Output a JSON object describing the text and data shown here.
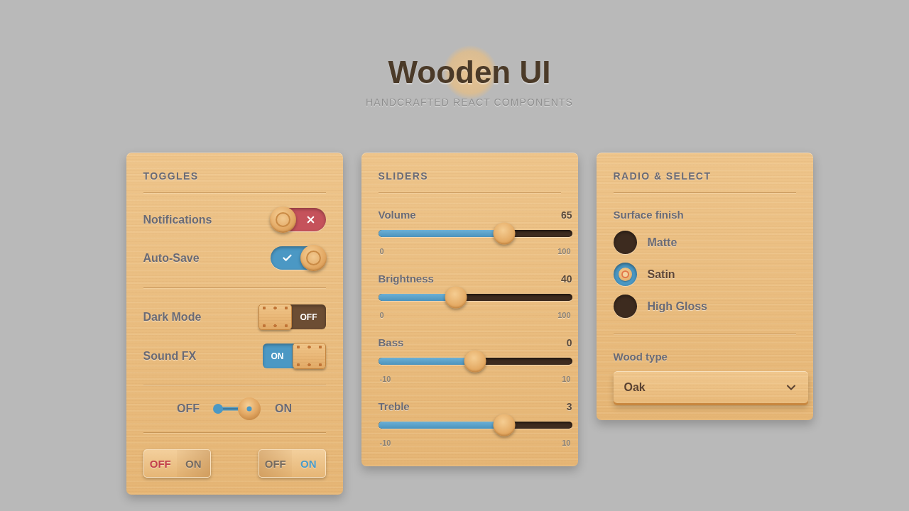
{
  "header": {
    "title": "Wooden UI",
    "subtitle": "HANDCRAFTED REACT COMPONENTS"
  },
  "toggles_panel": {
    "title": "TOGGLES",
    "pill_switches": [
      {
        "label": "Notifications",
        "on": false
      },
      {
        "label": "Auto-Save",
        "on": true
      }
    ],
    "block_switches": [
      {
        "label": "Dark Mode",
        "on": false,
        "state_text": "OFF"
      },
      {
        "label": "Sound FX",
        "on": true,
        "state_text": "ON"
      }
    ],
    "lever_switch": {
      "off_label": "OFF",
      "on_label": "ON",
      "on": true
    },
    "segmented_switches": [
      {
        "segments": [
          {
            "label": "OFF",
            "selected": true
          },
          {
            "label": "ON",
            "selected": false
          }
        ]
      },
      {
        "segments": [
          {
            "label": "OFF",
            "selected": false
          },
          {
            "label": "ON",
            "selected": true
          }
        ]
      }
    ]
  },
  "sliders_panel": {
    "title": "SLIDERS",
    "sliders": [
      {
        "label": "Volume",
        "reading": "65",
        "level": 0.65,
        "min": "0",
        "max": "100"
      },
      {
        "label": "Brightness",
        "reading": "40",
        "level": 0.4,
        "min": "0",
        "max": "100"
      },
      {
        "label": "Bass",
        "reading": "0",
        "level": 0.5,
        "min": "-10",
        "max": "10"
      },
      {
        "label": "Treble",
        "reading": "3",
        "level": 0.65,
        "min": "-10",
        "max": "10"
      }
    ]
  },
  "radio_select_panel": {
    "title": "RADIO & SELECT",
    "radio_group": {
      "label": "Surface finish",
      "options": [
        {
          "label": "Matte",
          "selected": false
        },
        {
          "label": "Satin",
          "selected": true
        },
        {
          "label": "High Gloss",
          "selected": false
        }
      ]
    },
    "select": {
      "label": "Wood type",
      "value": "Oak"
    }
  }
}
